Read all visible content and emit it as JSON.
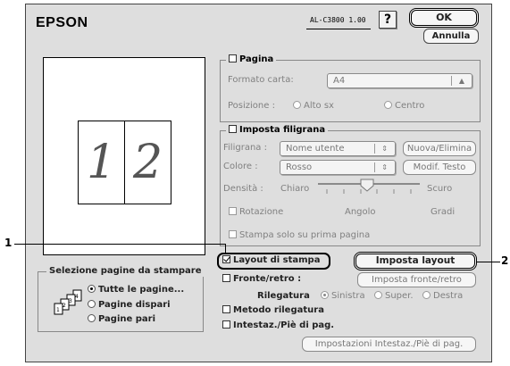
{
  "brand": "EPSON",
  "model": "AL-C3800 1.00",
  "help_label": "?",
  "buttons": {
    "ok": "OK",
    "cancel": "Annulla",
    "new_delete": "Nuova/Elimina",
    "edit_text": "Modif. Testo",
    "layout_setup": "Imposta layout",
    "duplex_setup": "Imposta fronte/retro",
    "header_footer_setup": "Impostazioni Intestaz./Piè di pag."
  },
  "preview": {
    "page1": "1",
    "page2": "2"
  },
  "page_group": {
    "title": "Pagina",
    "paper_size_label": "Formato carta:",
    "paper_size_value": "A4",
    "position_label": "Posizione :",
    "position_top_left": "Alto sx",
    "position_center": "Centro"
  },
  "watermark_group": {
    "title": "Imposta filigrana",
    "watermark_label": "Filigrana :",
    "watermark_value": "Nome utente",
    "color_label": "Colore :",
    "color_value": "Rosso",
    "density_label": "Densità :",
    "density_light": "Chiaro",
    "density_dark": "Scuro",
    "rotation_label": "Rotazione",
    "angle_label": "Angolo",
    "degrees_label": "Gradi",
    "first_page_only_label": "Stampa solo su prima pagina"
  },
  "page_selection": {
    "title": "Selezione pagine da stampare",
    "all_pages": "Tutte le pagine...",
    "odd_pages": "Pagine dispari",
    "even_pages": "Pagine pari"
  },
  "print_layout_label": "Layout di stampa",
  "duplex": {
    "label": "Fronte/retro :",
    "binding_label": "Rilegatura",
    "left": "Sinistra",
    "top": "Super.",
    "right": "Destra"
  },
  "binding_method_label": "Metodo rilegatura",
  "header_footer_label": "Intestaz./Piè di pag.",
  "callouts": {
    "one": "1",
    "two": "2"
  },
  "icons": {
    "pages_icon": "stacked-pages-1-2-3-4"
  }
}
